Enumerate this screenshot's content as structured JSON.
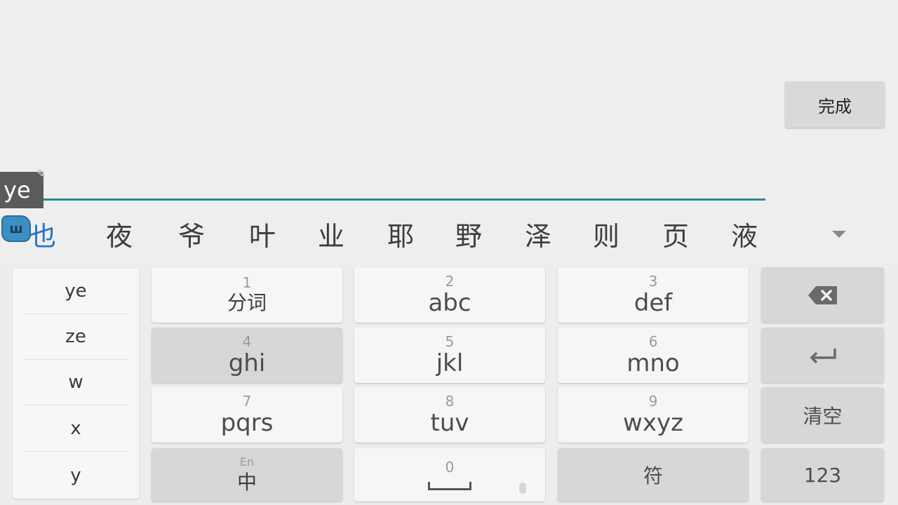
{
  "toolbar": {
    "done_label": "完成"
  },
  "composition": {
    "text": "ye",
    "pencil_glyph": "✎"
  },
  "logo": {
    "glyph": "ш"
  },
  "candidates": [
    "也",
    "夜",
    "爷",
    "叶",
    "业",
    "耶",
    "野",
    "泽",
    "则",
    "页",
    "液"
  ],
  "pinyin_options": [
    "ye",
    "ze",
    "w",
    "x",
    "y"
  ],
  "keys": {
    "k1": {
      "num": "1",
      "label": "分词"
    },
    "k2": {
      "num": "2",
      "label": "abc"
    },
    "k3": {
      "num": "3",
      "label": "def"
    },
    "k4": {
      "num": "4",
      "label": "ghi"
    },
    "k5": {
      "num": "5",
      "label": "jkl"
    },
    "k6": {
      "num": "6",
      "label": "mno"
    },
    "k7": {
      "num": "7",
      "label": "pqrs"
    },
    "k8": {
      "num": "8",
      "label": "tuv"
    },
    "k9": {
      "num": "9",
      "label": "wxyz"
    },
    "k0": {
      "num": "0"
    },
    "lang": {
      "sub": "En",
      "label": "中"
    },
    "symbols": {
      "label": "符"
    },
    "clear": {
      "label": "清空"
    },
    "numeric": {
      "label": "123"
    }
  },
  "colors": {
    "accent_underline": "#2a8d83",
    "candidate_highlight": "#1f72c7"
  },
  "icons": {
    "backspace": "backspace-icon",
    "enter": "enter-icon",
    "expand": "chevron-down-icon",
    "space": "space-bar-icon",
    "mic": "mic-icon",
    "pencil": "pencil-icon"
  }
}
